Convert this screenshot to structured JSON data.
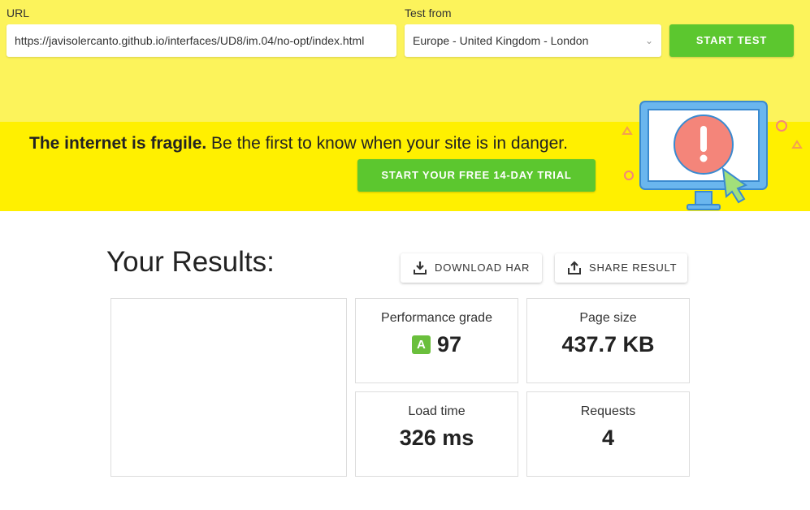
{
  "form": {
    "url_label": "URL",
    "url_value": "https://javisolercanto.github.io/interfaces/UD8/im.04/no-opt/index.html",
    "test_from_label": "Test from",
    "test_from_value": "Europe - United Kingdom - London",
    "start_test": "START TEST"
  },
  "banner": {
    "bold": "The internet is fragile.",
    "text": " Be the first to know when your site is in danger.",
    "cta": "START YOUR FREE 14-DAY TRIAL"
  },
  "results": {
    "title": "Your Results:",
    "download": "DOWNLOAD HAR",
    "share": "SHARE RESULT",
    "performance_label": "Performance grade",
    "grade": "A",
    "performance_value": "97",
    "page_size_label": "Page size",
    "page_size_value": "437.7 KB",
    "load_time_label": "Load time",
    "load_time_value": "326 ms",
    "requests_label": "Requests",
    "requests_value": "4"
  },
  "colors": {
    "accent_green": "#5cc72f",
    "banner_yellow": "#fff000",
    "top_yellow": "#fcf35b"
  }
}
